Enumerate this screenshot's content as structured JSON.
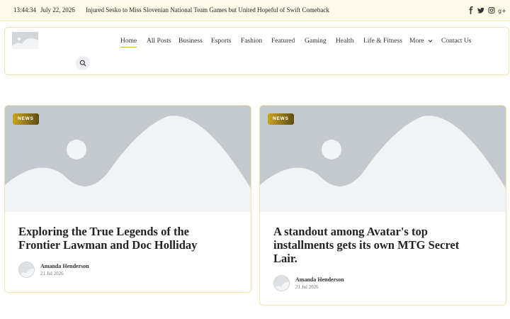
{
  "topbar": {
    "time": "13:44:34",
    "date": "July 22, 2026",
    "ticker": "Injured Sesko to Miss Slovenian National Team Games but United Hopeful of Swift Comeback",
    "social": [
      "facebook-icon",
      "twitter-icon",
      "instagram-icon",
      "google-plus-icon"
    ]
  },
  "nav": {
    "items": [
      "Home",
      "All Posts",
      "Business",
      "Esports",
      "Fashion",
      "Featured",
      "Gaming",
      "Health",
      "Life & Fitness",
      "More",
      "Contact Us"
    ],
    "active": "Home"
  },
  "posts": [
    {
      "category": "NEWS",
      "title_line1": "Exploring the True Legends of the",
      "title_line2": "Frontier Lawman and Doc Holliday",
      "title_line3": "",
      "author": "Amanda Henderson",
      "date": "21 Jul 2026"
    },
    {
      "category": "NEWS",
      "title_line1": "A standout among Avatar's top",
      "title_line2": "installments gets its own MTG Secret",
      "title_line3": "Lair.",
      "author": "Amanda Henderson",
      "date": "21 Jul 2026"
    }
  ],
  "colors": {
    "topbar_bg": "#fdfae8",
    "accent_gold": "#d8b43a",
    "badge_start": "#c9a41f",
    "badge_end": "#5f4d14",
    "placeholder": "#c4c9d0"
  }
}
